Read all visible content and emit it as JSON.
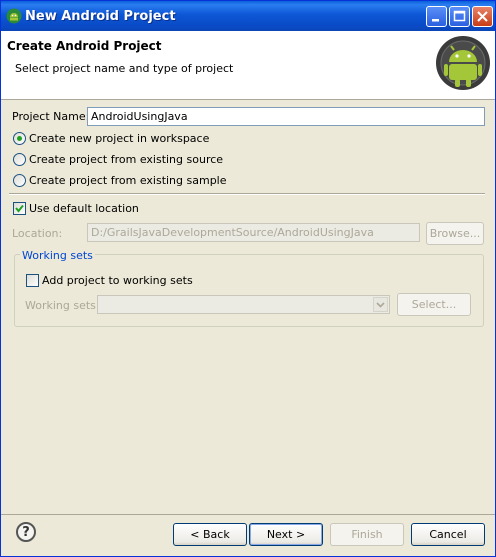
{
  "window": {
    "title": "New Android Project"
  },
  "banner": {
    "title": "Create Android Project",
    "subtitle": "Select project name and type of project"
  },
  "project_name": {
    "label": "Project Name:",
    "value": "AndroidUsingJava"
  },
  "radios": [
    {
      "label": "Create new project in workspace",
      "checked": true
    },
    {
      "label": "Create project from existing source",
      "checked": false
    },
    {
      "label": "Create project from existing sample",
      "checked": false
    }
  ],
  "use_default_location": {
    "label": "Use default location",
    "checked": true
  },
  "location": {
    "label": "Location:",
    "value": "D:/GrailsJavaDevelopmentSource/AndroidUsingJava",
    "browse_label": "Browse..."
  },
  "working_sets": {
    "group_title": "Working sets",
    "add_label": "Add project to working sets",
    "sets_label": "Working sets:",
    "select_label": "Select..."
  },
  "footer": {
    "help_label": "?",
    "back_label": "< Back",
    "next_label": "Next >",
    "finish_label": "Finish",
    "cancel_label": "Cancel"
  },
  "colors": {
    "title_bar": "#0a4bc7",
    "dialog_bg": "#ece9d8",
    "group_title": "#0046d5",
    "radio_dot": "#21a121"
  },
  "icons": [
    "android-icon",
    "minimize-icon",
    "maximize-icon",
    "close-icon",
    "android-logo-icon",
    "checkmark-icon",
    "dropdown-arrow-icon",
    "help-icon"
  ]
}
